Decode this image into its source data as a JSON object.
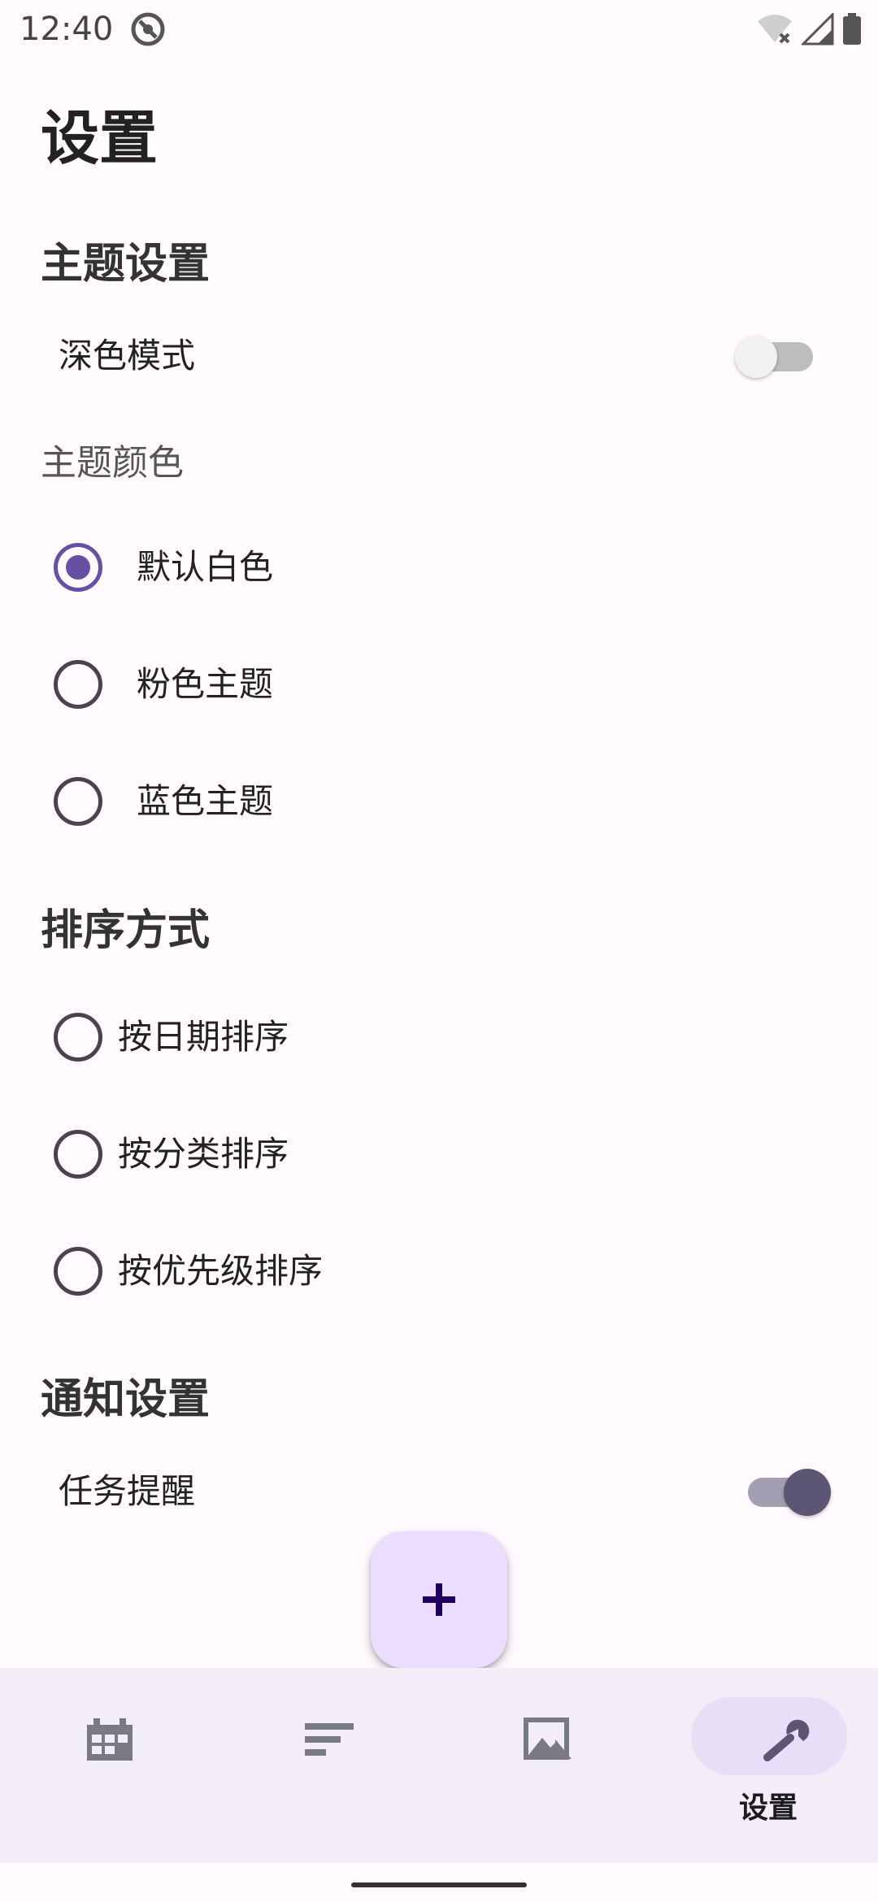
{
  "status_bar": {
    "time": "12:40"
  },
  "page": {
    "title": "设置"
  },
  "theme_settings": {
    "heading": "主题设置",
    "dark_mode": {
      "label": "深色模式",
      "enabled": false
    },
    "theme_color": {
      "label": "主题颜色",
      "options": [
        {
          "label": "默认白色",
          "selected": true
        },
        {
          "label": "粉色主题",
          "selected": false
        },
        {
          "label": "蓝色主题",
          "selected": false
        }
      ]
    }
  },
  "sort_settings": {
    "heading": "排序方式",
    "options": [
      {
        "label": "按日期排序",
        "selected": false
      },
      {
        "label": "按分类排序",
        "selected": false
      },
      {
        "label": "按优先级排序",
        "selected": false
      }
    ]
  },
  "notification_settings": {
    "heading": "通知设置",
    "task_reminder": {
      "label": "任务提醒",
      "enabled": true
    }
  },
  "fab": {
    "icon": "plus-icon"
  },
  "bottom_nav": {
    "items": [
      {
        "icon": "calendar-icon",
        "label": "",
        "active": false
      },
      {
        "icon": "sort-icon",
        "label": "",
        "active": false
      },
      {
        "icon": "image-icon",
        "label": "",
        "active": false
      },
      {
        "icon": "wrench-icon",
        "label": "设置",
        "active": true
      }
    ]
  },
  "colors": {
    "primary": "#6750a4",
    "fab_background": "#eaddff",
    "nav_background": "#f3edf7",
    "nav_indicator": "#e8def8"
  }
}
